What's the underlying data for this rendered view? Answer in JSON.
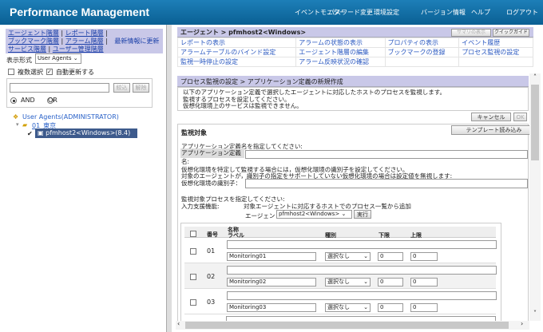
{
  "header": {
    "title": "Performance Management",
    "nav": [
      "イベントモニター",
      "パスワード変更",
      "環境設定",
      "バージョン情報",
      "ヘルプ",
      "ログアウト"
    ]
  },
  "left": {
    "nav_links": [
      "エージェント階層",
      "レポート階層",
      "ブックマーク階層",
      "アラーム階層",
      "サービス階層",
      "ユーザー管理階層"
    ],
    "refresh": "最新情報に更新",
    "display_label": "表示形式",
    "display_value": "User Agents",
    "multi_select": "複数選択",
    "auto_refresh": "自動更新する",
    "filter_value": "",
    "filter_btn": "絞込",
    "clear_btn": "解除",
    "and": "AND",
    "or": "OR",
    "tree": {
      "root": "User Agents(ADMINISTRATOR)",
      "folder": "01_東京",
      "host": "pfmhost2<Windows>(8.4)"
    }
  },
  "agent": {
    "breadcrumb": "エージェント > pfmhost2<Windows>",
    "summary_btn": "サマリの表示",
    "quickguide_btn": "クイックガイド",
    "links": [
      "レポートの表示",
      "アラームの状態の表示",
      "プロパティの表示",
      "イベント履歴",
      "アラームテーブルのバインド設定",
      "エージェント階層の編集",
      "ブックマークの登録",
      "プロセス監視の設定",
      "監視一時停止の設定",
      "アラーム反映状況の確認"
    ]
  },
  "process": {
    "breadcrumb": "プロセス監視の設定 > アプリケーション定義の新規作成",
    "desc": [
      "以下のアプリケーション定義で選択したエージェントに対応したホストのプロセスを監視します。",
      "監視するプロセスを設定してください。",
      "仮想化環境上のサービスは監視できません。"
    ],
    "cancel": "キャンセル",
    "ok": "OK",
    "section": "監視対象",
    "template_btn": "テンプレート読み込み",
    "app_prompt": "アプリケーション定義名を指定してください:",
    "app_label": "アプリケーション定義名:",
    "app_value": "",
    "virt_prompt1": "仮想化環境を特定して監視する場合には，仮想化環境の識別子を設定してください。",
    "virt_prompt2": "対象のエージェントが，識別子の指定をサポートしていない仮想化環境の場合は設定値を無視します:",
    "virt_label": "仮想化環境の識別子：",
    "virt_value": "",
    "proc_prompt": "監視対象プロセスを指定してください:",
    "assist_label": "入力支援機能:",
    "assist_text": "対象エージェントに対応するホストでのプロセス一覧から追加",
    "agent_label": "エージェント",
    "agent_value": "pfmhost2<Windows>",
    "run_btn": "実行",
    "table": {
      "headers": {
        "no": "番号",
        "name": "名称",
        "label": "ラベル",
        "type": "種別",
        "lower": "下限",
        "upper": "上限"
      },
      "rows": [
        {
          "no": "01",
          "name": "",
          "label": "Monitoring01",
          "type": "選択なし",
          "lower": "0",
          "upper": "0"
        },
        {
          "no": "02",
          "name": "",
          "label": "Monitoring02",
          "type": "選択なし",
          "lower": "0",
          "upper": "0"
        },
        {
          "no": "03",
          "name": "",
          "label": "Monitoring03",
          "type": "選択なし",
          "lower": "0",
          "upper": "0"
        }
      ]
    }
  }
}
